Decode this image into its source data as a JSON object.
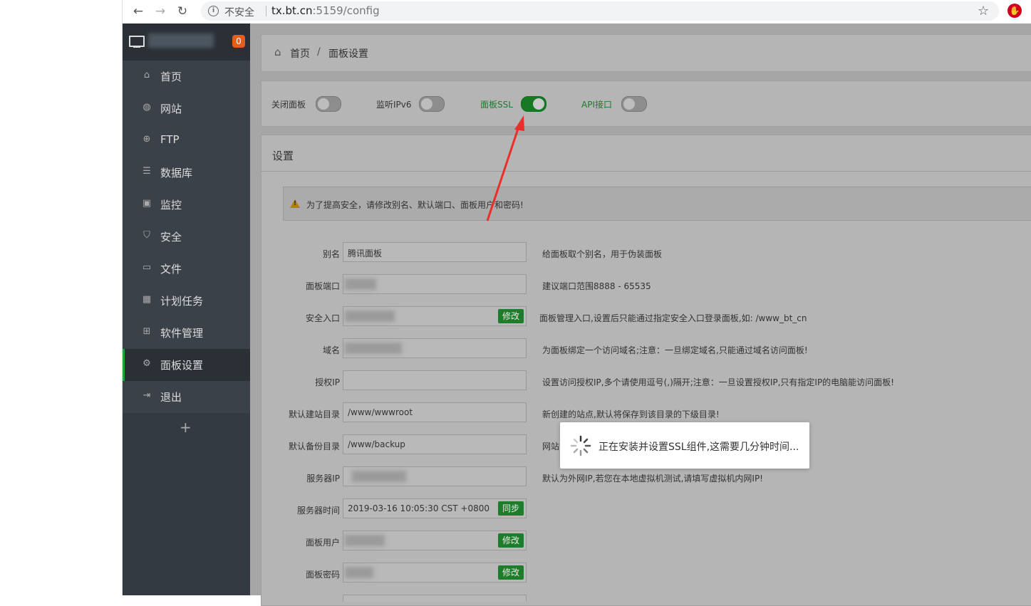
{
  "browser": {
    "security": "不安全",
    "host": "tx.bt.cn",
    "path": ":5159/config"
  },
  "sidebar": {
    "badge": "0",
    "items": [
      {
        "label": "首页",
        "icon": "home-icon"
      },
      {
        "label": "网站",
        "icon": "globe-icon"
      },
      {
        "label": "FTP",
        "icon": "ftp-icon"
      },
      {
        "label": "数据库",
        "icon": "database-icon"
      },
      {
        "label": "监控",
        "icon": "monitor-icon"
      },
      {
        "label": "安全",
        "icon": "shield-icon"
      },
      {
        "label": "文件",
        "icon": "folder-icon"
      },
      {
        "label": "计划任务",
        "icon": "calendar-icon"
      },
      {
        "label": "软件管理",
        "icon": "apps-icon"
      },
      {
        "label": "面板设置",
        "icon": "gear-icon",
        "active": true
      },
      {
        "label": "退出",
        "icon": "logout-icon"
      }
    ],
    "add": "+"
  },
  "breadcrumb": {
    "home": "首页",
    "sep": "/",
    "current": "面板设置"
  },
  "switches": {
    "close_panel": {
      "label": "关闭面板",
      "on": false
    },
    "ipv6": {
      "label": "监听IPv6",
      "on": false
    },
    "ssl": {
      "label": "面板SSL",
      "on": true
    },
    "api": {
      "label": "API接口",
      "on": false
    }
  },
  "settings": {
    "title": "设置",
    "warning": "为了提高安全，请修改别名、默认端口、面板用户和密码!",
    "rows": {
      "alias": {
        "label": "别名",
        "value": "腾讯面板",
        "hint": "给面板取个别名，用于伪装面板"
      },
      "port": {
        "label": "面板端口",
        "value": "",
        "hint": "建议端口范围8888 - 65535"
      },
      "entry": {
        "label": "安全入口",
        "value": "",
        "button": "修改",
        "hint": "面板管理入口,设置后只能通过指定安全入口登录面板,如: /www_bt_cn"
      },
      "domain": {
        "label": "域名",
        "value": "",
        "hint": "为面板绑定一个访问域名;注意：一旦绑定域名,只能通过域名访问面板!"
      },
      "auth_ip": {
        "label": "授权IP",
        "value": "",
        "hint": "设置访问授权IP,多个请使用逗号(,)隔开;注意：一旦设置授权IP,只有指定IP的电脑能访问面板!"
      },
      "site_dir": {
        "label": "默认建站目录",
        "value": "/www/wwwroot",
        "hint": "新创建的站点,默认将保存到该目录的下级目录!"
      },
      "backup_dir": {
        "label": "默认备份目录",
        "value": "/www/backup",
        "hint": "网站"
      },
      "server_ip": {
        "label": "服务器IP",
        "value": "",
        "hint": "默认为外网IP,若您在本地虚拟机测试,请填写虚拟机内网IP!"
      },
      "server_time": {
        "label": "服务器时间",
        "value": "2019-03-16 10:05:30 CST +0800",
        "button": "同步"
      },
      "user": {
        "label": "面板用户",
        "value": "",
        "button": "修改"
      },
      "password": {
        "label": "面板密码",
        "value": "",
        "button": "修改"
      }
    }
  },
  "toast": {
    "message": "正在安装并设置SSL组件,这需要几分钟时间..."
  }
}
